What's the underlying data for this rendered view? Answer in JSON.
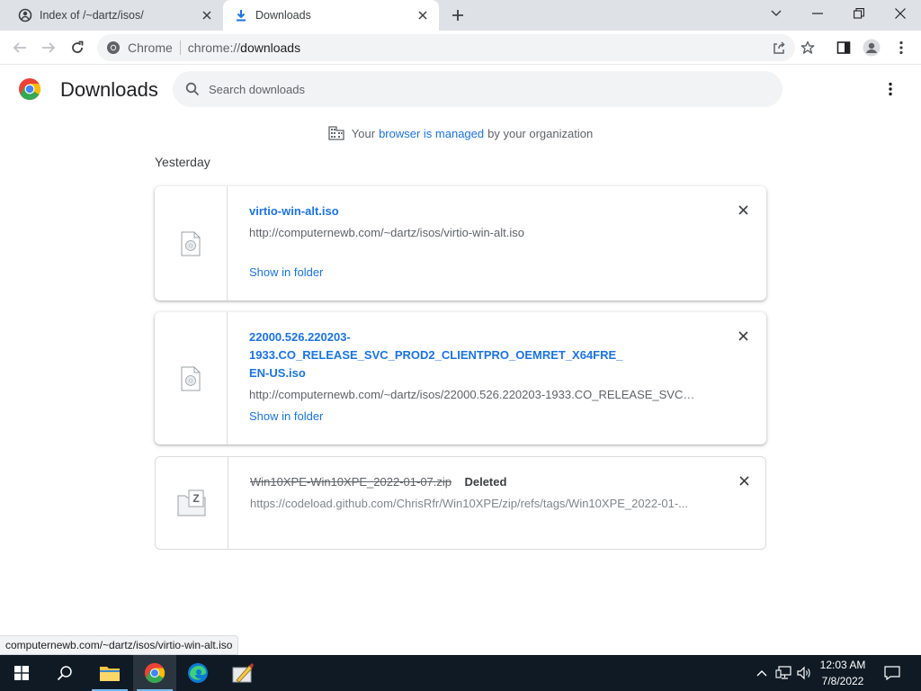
{
  "tabs": [
    {
      "title": "Index of /~dartz/isos/"
    },
    {
      "title": "Downloads"
    }
  ],
  "omnibox": {
    "chip_label": "Chrome",
    "url_scheme": "chrome://",
    "url_path": "downloads"
  },
  "page": {
    "title": "Downloads",
    "search_placeholder": "Search downloads"
  },
  "managed": {
    "prefix": "Your",
    "link": "browser is managed",
    "suffix": "by your organization"
  },
  "section_date": "Yesterday",
  "downloads": [
    {
      "filename": "virtio-win-alt.iso",
      "url": "http://computernewb.com/~dartz/isos/virtio-win-alt.iso",
      "action": "Show in folder"
    },
    {
      "filename_line1": "22000.526.220203-1933.CO_RELEASE_SVC_PROD2_CLIENTPRO_OEMRET_X64FRE_",
      "filename_line2": "EN-US.iso",
      "url": "http://computernewb.com/~dartz/isos/22000.526.220203-1933.CO_RELEASE_SVC_...",
      "action": "Show in folder"
    },
    {
      "filename": "Win10XPE-Win10XPE_2022-01-07.zip",
      "status": "Deleted",
      "url": "https://codeload.github.com/ChrisRfr/Win10XPE/zip/refs/tags/Win10XPE_2022-01-..."
    }
  ],
  "status_bubble": "computernewb.com/~dartz/isos/virtio-win-alt.iso",
  "clock": {
    "time": "12:03 AM",
    "date": "7/8/2022"
  },
  "colors": {
    "accent": "#1a73e8",
    "taskbar": "#0f1a24",
    "tabstrip": "#dee1e6"
  }
}
